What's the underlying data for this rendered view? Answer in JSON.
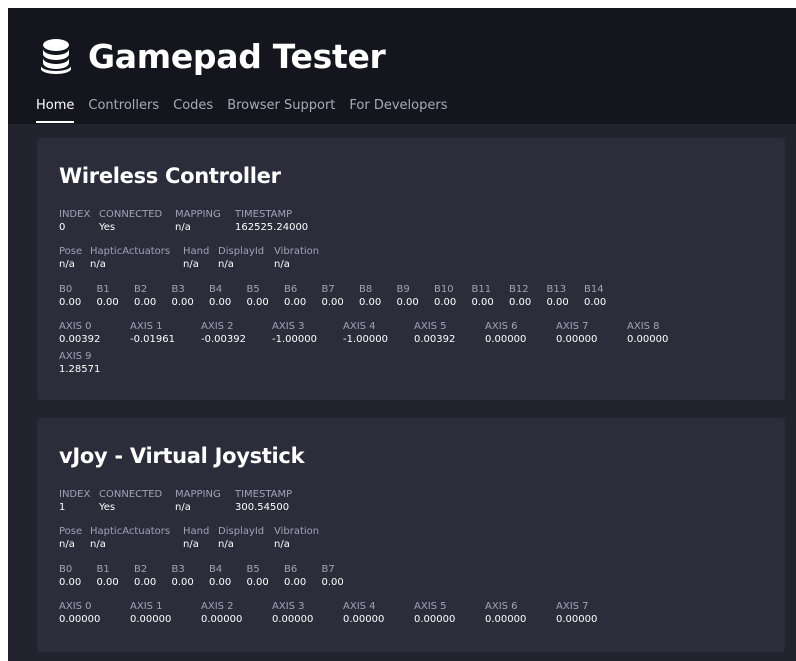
{
  "header": {
    "title": "Gamepad Tester",
    "logo_icon": "database-stack-icon",
    "nav": [
      "Home",
      "Controllers",
      "Codes",
      "Browser Support",
      "For Developers"
    ],
    "active_nav": "Home"
  },
  "controllers": [
    {
      "name": "Wireless Controller",
      "info": {
        "labels": [
          "INDEX",
          "CONNECTED",
          "MAPPING",
          "TIMESTAMP"
        ],
        "values": [
          "0",
          "Yes",
          "n/a",
          "162525.24000"
        ]
      },
      "extra": {
        "labels": [
          "Pose",
          "HapticActuators",
          "Hand",
          "DisplayId",
          "Vibration"
        ],
        "values": [
          "n/a",
          "n/a",
          "n/a",
          "n/a",
          "n/a"
        ]
      },
      "buttons": {
        "labels": [
          "B0",
          "B1",
          "B2",
          "B3",
          "B4",
          "B5",
          "B6",
          "B7",
          "B8",
          "B9",
          "B10",
          "B11",
          "B12",
          "B13",
          "B14"
        ],
        "values": [
          "0.00",
          "0.00",
          "0.00",
          "0.00",
          "0.00",
          "0.00",
          "0.00",
          "0.00",
          "0.00",
          "0.00",
          "0.00",
          "0.00",
          "0.00",
          "0.00",
          "0.00"
        ]
      },
      "axes": {
        "labels": [
          "AXIS 0",
          "AXIS 1",
          "AXIS 2",
          "AXIS 3",
          "AXIS 4",
          "AXIS 5",
          "AXIS 6",
          "AXIS 7",
          "AXIS 8",
          "AXIS 9"
        ],
        "values": [
          "0.00392",
          "-0.01961",
          "-0.00392",
          "-1.00000",
          "-1.00000",
          "0.00392",
          "0.00000",
          "0.00000",
          "0.00000",
          "1.28571"
        ]
      }
    },
    {
      "name": "vJoy - Virtual Joystick",
      "info": {
        "labels": [
          "INDEX",
          "CONNECTED",
          "MAPPING",
          "TIMESTAMP"
        ],
        "values": [
          "1",
          "Yes",
          "n/a",
          "300.54500"
        ]
      },
      "extra": {
        "labels": [
          "Pose",
          "HapticActuators",
          "Hand",
          "DisplayId",
          "Vibration"
        ],
        "values": [
          "n/a",
          "n/a",
          "n/a",
          "n/a",
          "n/a"
        ]
      },
      "buttons": {
        "labels": [
          "B0",
          "B1",
          "B2",
          "B3",
          "B4",
          "B5",
          "B6",
          "B7"
        ],
        "values": [
          "0.00",
          "0.00",
          "0.00",
          "0.00",
          "0.00",
          "0.00",
          "0.00",
          "0.00"
        ]
      },
      "axes": {
        "labels": [
          "AXIS 0",
          "AXIS 1",
          "AXIS 2",
          "AXIS 3",
          "AXIS 4",
          "AXIS 5",
          "AXIS 6",
          "AXIS 7"
        ],
        "values": [
          "0.00000",
          "0.00000",
          "0.00000",
          "0.00000",
          "0.00000",
          "0.00000",
          "0.00000",
          "0.00000"
        ]
      }
    }
  ],
  "colors": {
    "page_bg": "#23232f",
    "header_bg": "#15151e",
    "card_bg": "#2c2c3a",
    "label": "#a3a3b4",
    "value": "#ffffff"
  }
}
